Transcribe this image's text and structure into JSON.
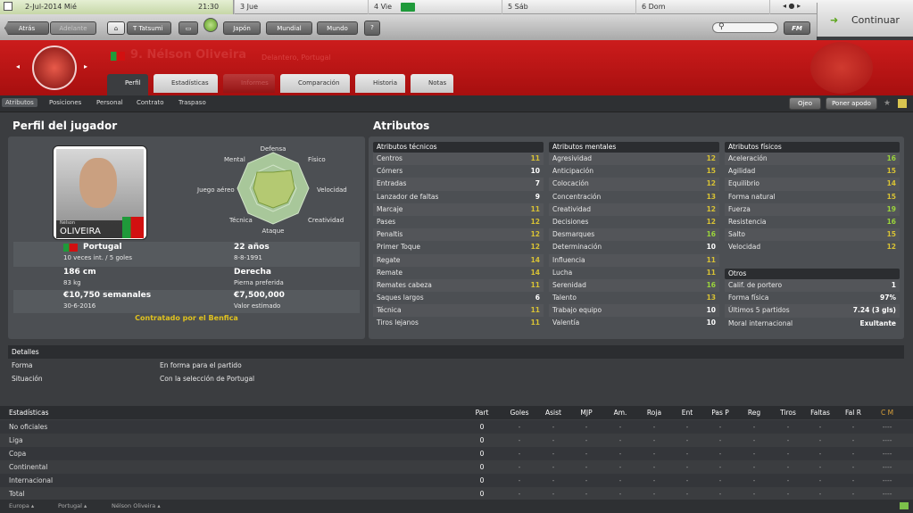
{
  "datebar": {
    "current_date": "2-Jul-2014 Mié",
    "time": "21:30",
    "days": [
      "3 Jue",
      "4 Vie",
      "5 Sáb",
      "6 Dom"
    ]
  },
  "nav": {
    "back": "Atrás",
    "forward": "Adelante",
    "manager": "T Tatsumi",
    "country_menu": "Japón",
    "world_menu": "Mundial",
    "world2_menu": "Mundo",
    "help": "?",
    "fm": "FM",
    "continue": "Continuar"
  },
  "player": {
    "number_name": "9. Nélson Oliveira",
    "position_nationality": "Delantero, Portugal",
    "card_name_small": "Nélson",
    "card_name": "OLIVEIRA"
  },
  "tabs": [
    "Perfil",
    "Estadísticas",
    "Informes",
    "Comparación",
    "Historia",
    "Notas"
  ],
  "subtabs": [
    "Atributos",
    "Posiciones",
    "Personal",
    "Contrato",
    "Traspaso"
  ],
  "subright": {
    "scout": "Ojeo",
    "nickname": "Poner apodo"
  },
  "profile": {
    "title": "Perfil del jugador",
    "nation": "Portugal",
    "caps": "10 veces int. / 5 goles",
    "age": "22 años",
    "dob": "8-8-1991",
    "height": "186 cm",
    "weight": "83 kg",
    "foot": "Derecha",
    "foot_label": "Pierna preferida",
    "wage": "€10,750 semanales",
    "contract_end": "30-6-2016",
    "value": "€7,500,000",
    "value_label": "Valor estimado",
    "contract_club": "Contratado por el Benfica"
  },
  "radar": {
    "labels": [
      "Defensa",
      "Físico",
      "Velocidad",
      "Creatividad",
      "Ataque",
      "Técnica",
      "Juego aéreo",
      "Mental"
    ]
  },
  "attributes": {
    "title": "Atributos",
    "technical": {
      "header": "Atributos técnicos",
      "items": [
        [
          "Centros",
          "11"
        ],
        [
          "Córners",
          "10"
        ],
        [
          "Entradas",
          "7"
        ],
        [
          "Lanzador de faltas",
          "9"
        ],
        [
          "Marcaje",
          "11"
        ],
        [
          "Pases",
          "12"
        ],
        [
          "Penaltis",
          "12"
        ],
        [
          "Primer Toque",
          "12"
        ],
        [
          "Regate",
          "14"
        ],
        [
          "Remate",
          "14"
        ],
        [
          "Remates cabeza",
          "11"
        ],
        [
          "Saques largos",
          "6"
        ],
        [
          "Técnica",
          "11"
        ],
        [
          "Tiros lejanos",
          "11"
        ]
      ]
    },
    "mental": {
      "header": "Atributos mentales",
      "items": [
        [
          "Agresividad",
          "12"
        ],
        [
          "Anticipación",
          "15"
        ],
        [
          "Colocación",
          "12"
        ],
        [
          "Concentración",
          "13"
        ],
        [
          "Creatividad",
          "12"
        ],
        [
          "Decisiones",
          "12"
        ],
        [
          "Desmarques",
          "16"
        ],
        [
          "Determinación",
          "10"
        ],
        [
          "Influencia",
          "11"
        ],
        [
          "Lucha",
          "11"
        ],
        [
          "Serenidad",
          "16"
        ],
        [
          "Talento",
          "13"
        ],
        [
          "Trabajo equipo",
          "10"
        ],
        [
          "Valentía",
          "10"
        ]
      ]
    },
    "physical": {
      "header": "Atributos físicos",
      "items": [
        [
          "Aceleración",
          "16"
        ],
        [
          "Agilidad",
          "15"
        ],
        [
          "Equilibrio",
          "14"
        ],
        [
          "Forma natural",
          "15"
        ],
        [
          "Fuerza",
          "19"
        ],
        [
          "Resistencia",
          "16"
        ],
        [
          "Salto",
          "15"
        ],
        [
          "Velocidad",
          "12"
        ]
      ]
    },
    "others": {
      "header": "Otros",
      "items": [
        [
          "Calif. de portero",
          "1"
        ],
        [
          "Forma física",
          "97%"
        ],
        [
          "Últimos 5 partidos",
          "7.24 (3 gls)"
        ],
        [
          "Moral internacional",
          "Exultante"
        ]
      ]
    }
  },
  "details": {
    "header": "Detalles",
    "rows": [
      [
        "Forma",
        "En forma para el partido"
      ],
      [
        "Situación",
        "Con la selección de Portugal"
      ]
    ]
  },
  "stats": {
    "header": "Estadísticas",
    "columns": [
      "Part",
      "Goles",
      "Asist",
      "MJP",
      "Am.",
      "Roja",
      "Ent",
      "Pas P",
      "Reg",
      "Tiros",
      "Faltas",
      "Fal R",
      "C M"
    ],
    "rows": [
      {
        "label": "No oficiales",
        "part": "0"
      },
      {
        "label": "Liga",
        "part": "0"
      },
      {
        "label": "Copa",
        "part": "0"
      },
      {
        "label": "Continental",
        "part": "0"
      },
      {
        "label": "Internacional",
        "part": "0"
      },
      {
        "label": "Total",
        "part": "0"
      }
    ],
    "dash": "-",
    "cm_dash": "----"
  },
  "footer": [
    "Europa",
    "Portugal",
    "Nélson Oliveira"
  ],
  "colors": {
    "accent_green": "#9bd43b",
    "header_red": "#c41818",
    "contract_yellow": "#e0c21e"
  }
}
